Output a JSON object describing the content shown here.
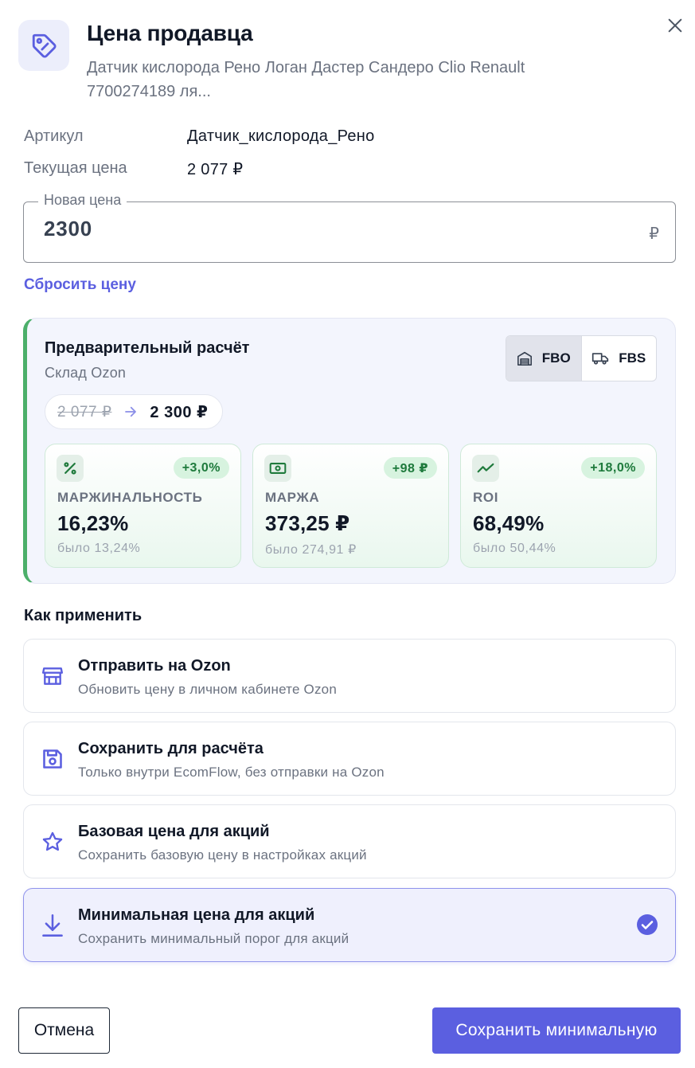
{
  "header": {
    "title": "Цена продавца",
    "subtitle": "Датчик кислорода Рено Логан Дастер Сандеро Clio Renault 7700274189 ля...",
    "icon": "price-tag-icon",
    "close_icon": "close-icon"
  },
  "info": {
    "sku_label": "Артикул",
    "sku_value": "Датчик_кислорода_Рено",
    "current_price_label": "Текущая цена",
    "current_price_value": "2 077 ₽"
  },
  "new_price": {
    "label": "Новая цена",
    "value": "2300",
    "currency": "₽"
  },
  "reset_label": "Сбросить цену",
  "preliminary": {
    "title": "Предварительный расчёт",
    "warehouse": "Склад Ozon",
    "toggle": [
      {
        "label": "FBO",
        "icon": "warehouse-icon",
        "active": true
      },
      {
        "label": "FBS",
        "icon": "truck-icon",
        "active": false
      }
    ],
    "old_price": "2 077 ₽",
    "new_price": "2 300 ₽",
    "metrics": [
      {
        "icon": "percent-icon",
        "delta": "+3,0%",
        "label": "МАРЖИНАЛЬНОСТЬ",
        "value": "16,23%",
        "was": "было 13,24%"
      },
      {
        "icon": "money-icon",
        "delta": "+98 ₽",
        "label": "МАРЖА",
        "value": "373,25 ₽",
        "was": "было 274,91 ₽"
      },
      {
        "icon": "trending-up-icon",
        "delta": "+18,0%",
        "label": "ROI",
        "value": "68,49%",
        "was": "было 50,44%"
      }
    ]
  },
  "apply": {
    "title": "Как применить",
    "options": [
      {
        "icon": "store-icon",
        "title": "Отправить на Ozon",
        "desc": "Обновить цену в личном кабинете Ozon",
        "selected": false
      },
      {
        "icon": "save-icon",
        "title": "Сохранить для расчёта",
        "desc": "Только внутри EcomFlow, без отправки на Ozon",
        "selected": false
      },
      {
        "icon": "star-icon",
        "title": "Базовая цена для акций",
        "desc": "Сохранить базовую цену в настройках акций",
        "selected": false
      },
      {
        "icon": "download-icon",
        "title": "Минимальная цена для акций",
        "desc": "Сохранить минимальный порог для акций",
        "selected": true
      }
    ]
  },
  "footer": {
    "cancel_label": "Отмена",
    "save_label": "Сохранить минимальную"
  },
  "colors": {
    "accent": "#5b5fe0",
    "success": "#1e7a3c",
    "card_border_left": "#4caf6a"
  }
}
